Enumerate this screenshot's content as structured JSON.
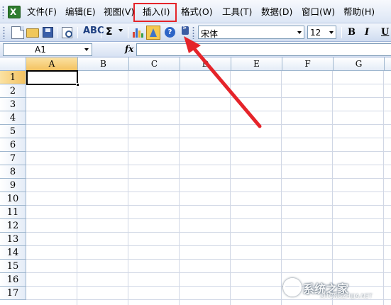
{
  "menu": {
    "items": [
      "文件(F)",
      "编辑(E)",
      "视图(V)",
      "插入(I)",
      "格式(O)",
      "工具(T)",
      "数据(D)",
      "窗口(W)",
      "帮助(H)"
    ],
    "highlighted": "插入(I)",
    "highlight_color": "#e5242a"
  },
  "toolbar": {
    "font_name": "宋体",
    "font_size": "12",
    "bold_label": "B",
    "italic_label": "I",
    "underline_label": "U",
    "sum_label": "Σ",
    "help_label": "?",
    "icons": [
      "new-icon",
      "open-icon",
      "save-icon",
      "print-preview-icon",
      "spelling-icon",
      "autosum-icon",
      "chart-wizard-icon",
      "drawing-icon",
      "help-icon",
      "toolbar-options-icon"
    ]
  },
  "formula_bar": {
    "name_box": "A1",
    "fx_label": "fx",
    "content": ""
  },
  "sheet": {
    "columns": [
      "A",
      "B",
      "C",
      "D",
      "E",
      "F",
      "G"
    ],
    "rows": [
      "1",
      "2",
      "3",
      "4",
      "5",
      "6",
      "7",
      "8",
      "9",
      "10",
      "11",
      "12",
      "13",
      "14",
      "15",
      "16",
      "17"
    ],
    "active_cell": "A1"
  },
  "watermark": {
    "text": "系统之家",
    "url": "XITONGZHIJIA.NET"
  },
  "annotation": {
    "arrow_color": "#e5242a"
  }
}
